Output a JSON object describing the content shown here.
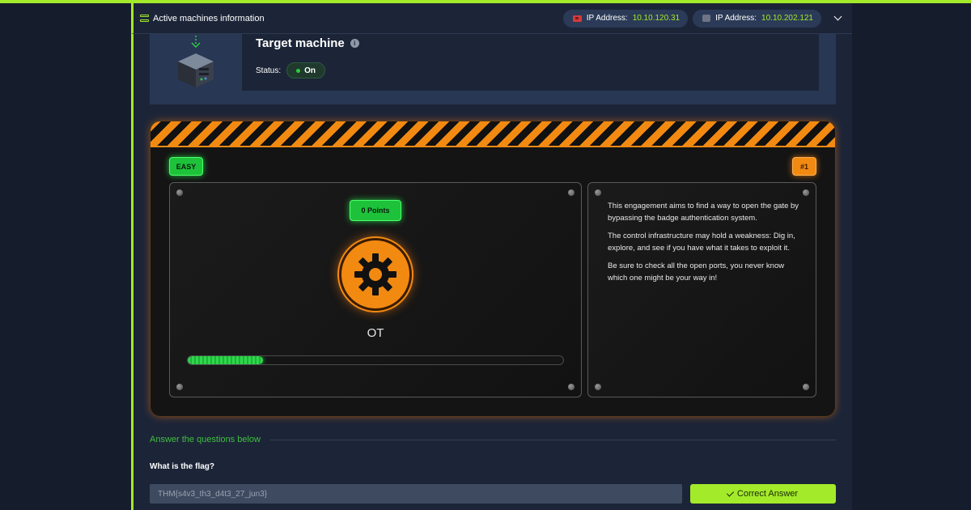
{
  "header": {
    "title": "Active machines information",
    "machines": [
      {
        "icon": "flag-icon",
        "label": "IP Address:",
        "ip": "10.10.120.31"
      },
      {
        "icon": "box-icon",
        "label": "IP Address:",
        "ip": "10.10.202.121"
      }
    ]
  },
  "target": {
    "title": "Target machine",
    "status_label": "Status:",
    "status_value": "On"
  },
  "challenge": {
    "difficulty": "EASY",
    "number": "#1",
    "points": "0 Points",
    "category": "OT",
    "progress": 0.2,
    "description": [
      "This engagement aims to find a way to open the gate by bypassing the badge authentication system.",
      "The control infrastructure may hold a weakness: Dig in, explore, and see if you have what it takes to exploit it.",
      "Be sure to check all the open ports, you never know which one might be your way in!"
    ]
  },
  "answers": {
    "heading": "Answer the questions below",
    "question": "What is the flag?",
    "answer_value": "THM{s4v3_th3_d4t3_27_jun3}",
    "button_label": "Correct Answer"
  },
  "colors": {
    "accent": "#a3ea2a",
    "hazard_orange": "#f28a12",
    "easy_green": "#1ec23a"
  }
}
